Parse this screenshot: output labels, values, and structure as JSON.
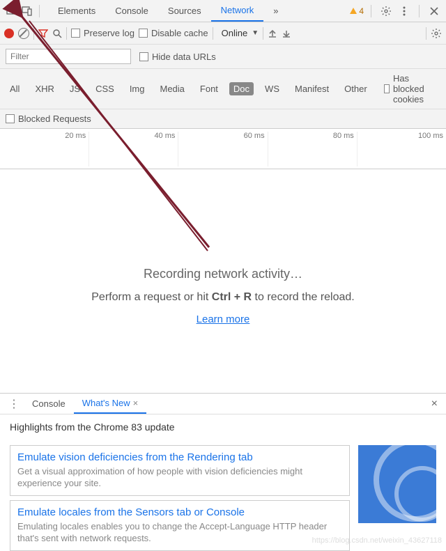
{
  "tabs": {
    "items": [
      "Elements",
      "Console",
      "Sources",
      "Network"
    ],
    "active_index": 3,
    "more_glyph": "»",
    "warning_count": "4"
  },
  "toolbar": {
    "preserve_log": "Preserve log",
    "disable_cache": "Disable cache",
    "throttle": "Online",
    "throttle_caret": "▼"
  },
  "filter": {
    "placeholder": "Filter",
    "hide_urls": "Hide data URLs"
  },
  "type_filters": {
    "items": [
      "All",
      "XHR",
      "JS",
      "CSS",
      "Img",
      "Media",
      "Font",
      "Doc",
      "WS",
      "Manifest",
      "Other"
    ],
    "selected_index": 7,
    "has_blocked": "Has blocked cookies"
  },
  "blocked_row": {
    "label": "Blocked Requests"
  },
  "timeline": {
    "ticks": [
      "20 ms",
      "40 ms",
      "60 ms",
      "80 ms",
      "100 ms"
    ]
  },
  "empty": {
    "recording": "Recording network activity…",
    "hint_pre": "Perform a request or hit ",
    "hint_key": "Ctrl + R",
    "hint_post": " to record the reload.",
    "learn": "Learn more"
  },
  "drawer": {
    "tabs": [
      "Console",
      "What's New"
    ],
    "active_index": 1,
    "close_glyph": "×",
    "highlights": "Highlights from the Chrome 83 update",
    "cards": [
      {
        "title": "Emulate vision deficiencies from the Rendering tab",
        "desc": "Get a visual approximation of how people with vision deficiencies might experience your site."
      },
      {
        "title": "Emulate locales from the Sensors tab or Console",
        "desc": "Emulating locales enables you to change the Accept-Language HTTP header that's sent with network requests."
      }
    ]
  },
  "watermark": "https://blog.csdn.net/weixin_43627118"
}
